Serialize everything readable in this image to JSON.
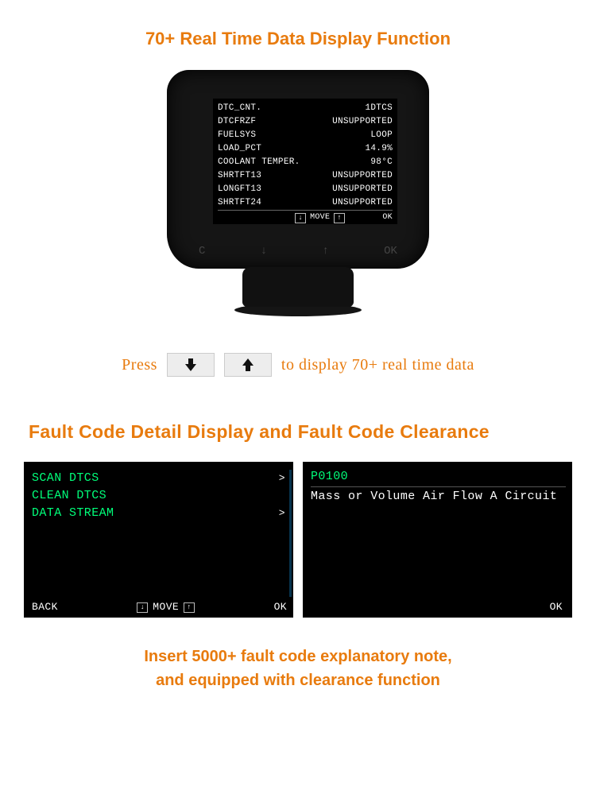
{
  "heading1": "70+ Real Time Data Display Function",
  "device": {
    "rows": [
      {
        "label": "DTC_CNT.",
        "value": "1DTCS"
      },
      {
        "label": "DTCFRZF",
        "value": "UNSUPPORTED"
      },
      {
        "label": "FUELSYS",
        "value": "LOOP"
      },
      {
        "label": "LOAD_PCT",
        "value": "14.9%"
      },
      {
        "label": "COOLANT TEMPER.",
        "value": "98°C"
      },
      {
        "label": "SHRTFT13",
        "value": "UNSUPPORTED"
      },
      {
        "label": "LONGFT13",
        "value": "UNSUPPORTED"
      },
      {
        "label": "SHRTFT24",
        "value": "UNSUPPORTED"
      }
    ],
    "footer": {
      "down": "↓",
      "move": "MOVE",
      "up": "↑",
      "ok": "OK"
    },
    "hwButtons": {
      "c": "C",
      "down": "↓",
      "up": "↑",
      "ok": "OK"
    }
  },
  "pressRow": {
    "press": "Press",
    "tail": "to display 70+ real time data"
  },
  "heading2": "Fault Code Detail Display and Fault Code Clearance",
  "panelLeft": {
    "items": [
      {
        "label": "SCAN DTCS",
        "chev": ">"
      },
      {
        "label": "CLEAN DTCS",
        "chev": ""
      },
      {
        "label": "DATA STREAM",
        "chev": ">"
      }
    ],
    "footer": {
      "back": "BACK",
      "down": "↓",
      "move": "MOVE",
      "up": "↑",
      "ok": "OK"
    }
  },
  "panelRight": {
    "code": "P0100",
    "desc": "Mass or Volume Air Flow A Circuit",
    "footer": {
      "ok": "OK"
    }
  },
  "footnote_l1": "Insert 5000+ fault code explanatory note,",
  "footnote_l2": "and equipped with clearance function"
}
